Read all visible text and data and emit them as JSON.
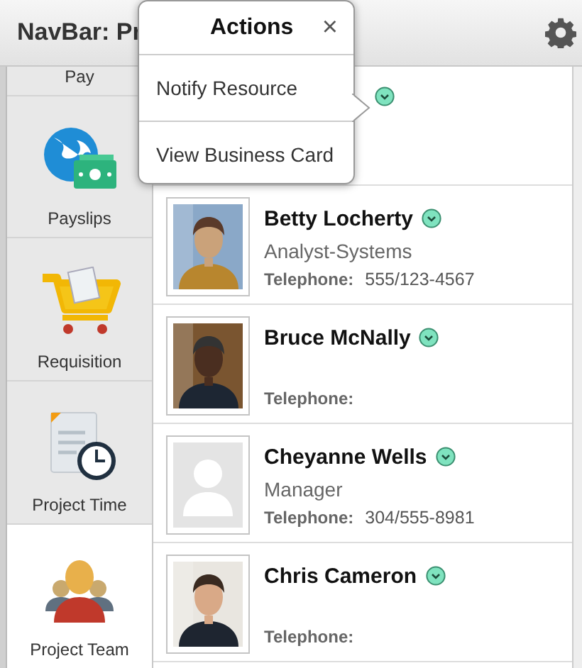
{
  "header": {
    "title": "NavBar: Pr"
  },
  "popup": {
    "title": "Actions",
    "close": "×",
    "items": [
      "Notify Resource",
      "View Business Card"
    ]
  },
  "sidebar": {
    "items": [
      {
        "label": "Pay",
        "kind": "partial",
        "selected": false
      },
      {
        "label": "Payslips",
        "kind": "payslips",
        "selected": false
      },
      {
        "label": "Requisition",
        "kind": "requisition",
        "selected": false
      },
      {
        "label": "Project Time",
        "kind": "time",
        "selected": false
      },
      {
        "label": "Project Team",
        "kind": "team",
        "selected": true
      }
    ]
  },
  "team": [
    {
      "kind": "partial"
    },
    {
      "kind": "person",
      "name": "Betty Locherty",
      "title": "Analyst-Systems",
      "phone_label": "Telephone:",
      "phone": "555/123-4567"
    },
    {
      "kind": "person",
      "name": "Bruce McNally",
      "phone_label": "Telephone:"
    },
    {
      "kind": "person",
      "photo": {
        "kind": "placeholder"
      },
      "name": "Cheyanne Wells",
      "title": "Manager",
      "phone_label": "Telephone:",
      "phone": "304/555-8981"
    },
    {
      "kind": "person",
      "name": "Chris Cameron",
      "phone_label": "Telephone:"
    }
  ]
}
